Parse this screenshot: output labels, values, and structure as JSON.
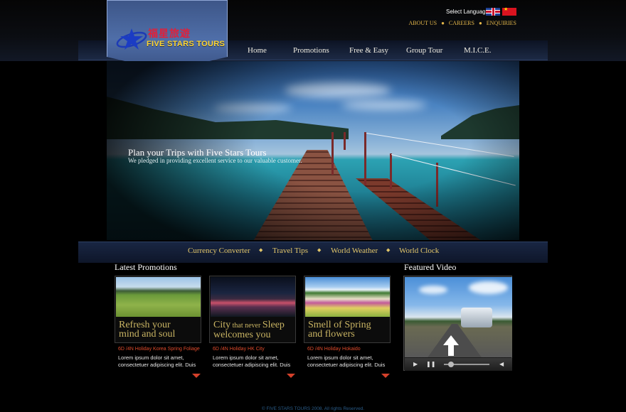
{
  "brand": {
    "chinese_name": "福星旅遊",
    "english_name": "FIVE STARS TOURS"
  },
  "language": {
    "label": "Select Language",
    "options": [
      "English",
      "Chinese"
    ]
  },
  "top_links": [
    "ABOUT US",
    "CAREERS",
    "ENQUIRIES"
  ],
  "nav": [
    "Home",
    "Promotions",
    "Free & Easy",
    "Group Tour",
    "M.I.C.E."
  ],
  "hero": {
    "title": "Plan your Trips with Five Stars Tours",
    "subtitle": "We pledged in providing excellent service to our valuable customer."
  },
  "quick_links": [
    "Currency Converter",
    "Travel Tips",
    "World Weather",
    "World Clock"
  ],
  "promotions": {
    "title": "Latest Promotions",
    "cards": [
      {
        "caption_line1": "Refresh your",
        "caption_line2": "mind and soul",
        "subtitle": "6D /4N Holiday Korea Spring Foliage",
        "desc": "Lorem ipsum dolor sit amet, consectetuer adipiscing elit. Duis"
      },
      {
        "caption_a": "City",
        "caption_b": " that never ",
        "caption_c": "Sleep",
        "caption_line2": "welcomes you",
        "subtitle": "6D /4N Holiday HK City",
        "desc": "Lorem ipsum dolor sit amet, consectetuer adipiscing elit. Duis"
      },
      {
        "caption_line1": "Smell of Spring",
        "caption_line2": "and flowers",
        "subtitle": "6D /4N Holiday Hokaido",
        "desc": "Lorem ipsum dolor sit amet, consectetuer adipiscing elit. Duis"
      }
    ]
  },
  "video": {
    "title": "Featured Video",
    "progress": 0.15
  },
  "footer": "© FIVE STARS TOURS 2008. All rights Reserved.",
  "colors": {
    "gold": "#e4b74a",
    "caption": "#c9b463",
    "accent_red": "#d4402a"
  }
}
